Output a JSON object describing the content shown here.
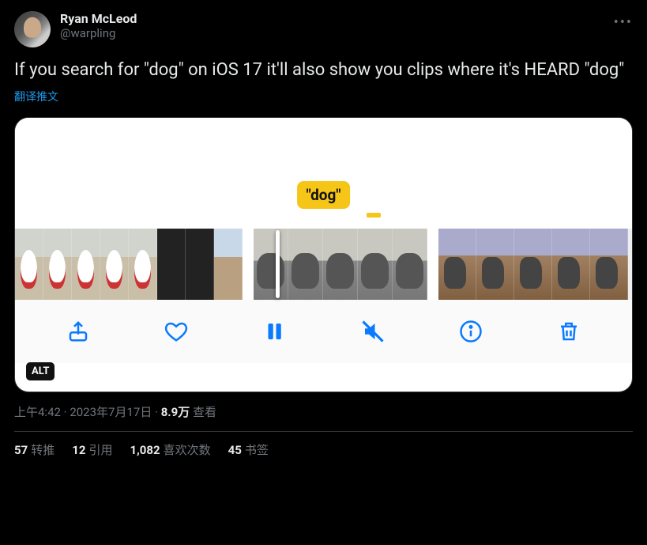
{
  "tweet": {
    "author": {
      "display_name": "Ryan McLeod",
      "handle": "@warpling"
    },
    "text": "If you search for \"dog\" on iOS 17 it'll also show you clips where it's HEARD \"dog\"",
    "translate_label": "翻译推文",
    "media": {
      "search_badge": "\"dog\"",
      "alt_badge": "ALT"
    },
    "meta": {
      "time": "上午4:42",
      "date": "2023年7月17日",
      "views_count": "8.9万",
      "views_label": "查看"
    },
    "stats": {
      "retweets": {
        "count": "57",
        "label": "转推"
      },
      "quotes": {
        "count": "12",
        "label": "引用"
      },
      "likes": {
        "count": "1,082",
        "label": "喜欢次数"
      },
      "bookmarks": {
        "count": "45",
        "label": "书签"
      }
    }
  }
}
